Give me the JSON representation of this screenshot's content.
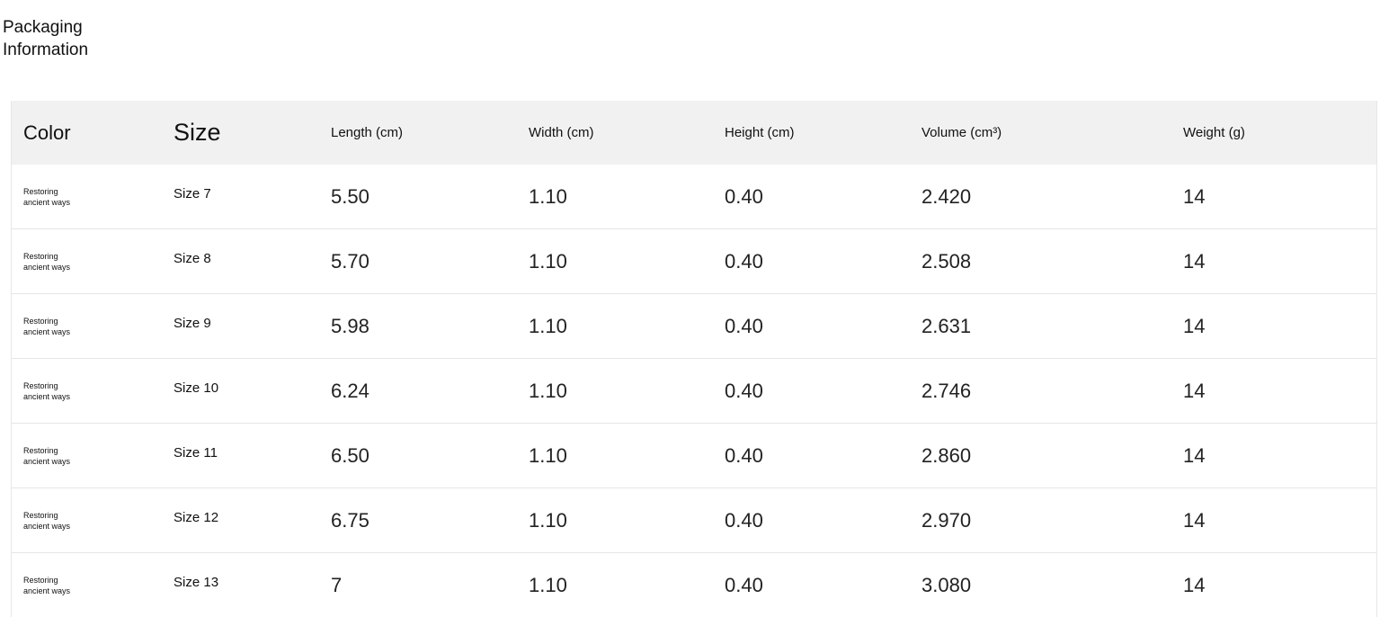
{
  "page": {
    "title": "Packaging\nInformation"
  },
  "table": {
    "headers": {
      "color": "Color",
      "size": "Size",
      "length": "Length (cm)",
      "width": "Width (cm)",
      "height": "Height (cm)",
      "volume": "Volume (cm³)",
      "weight": "Weight (g)"
    },
    "rows": [
      {
        "color": "Restoring ancient ways",
        "size": "Size 7",
        "length": "5.50",
        "width": "1.10",
        "height": "0.40",
        "volume": "2.420",
        "weight": "14"
      },
      {
        "color": "Restoring ancient ways",
        "size": "Size 8",
        "length": "5.70",
        "width": "1.10",
        "height": "0.40",
        "volume": "2.508",
        "weight": "14"
      },
      {
        "color": "Restoring ancient ways",
        "size": "Size 9",
        "length": "5.98",
        "width": "1.10",
        "height": "0.40",
        "volume": "2.631",
        "weight": "14"
      },
      {
        "color": "Restoring ancient ways",
        "size": "Size 10",
        "length": "6.24",
        "width": "1.10",
        "height": "0.40",
        "volume": "2.746",
        "weight": "14"
      },
      {
        "color": "Restoring ancient ways",
        "size": "Size 11",
        "length": "6.50",
        "width": "1.10",
        "height": "0.40",
        "volume": "2.860",
        "weight": "14"
      },
      {
        "color": "Restoring ancient ways",
        "size": "Size 12",
        "length": "6.75",
        "width": "1.10",
        "height": "0.40",
        "volume": "2.970",
        "weight": "14"
      },
      {
        "color": "Restoring ancient ways",
        "size": "Size 13",
        "length": "7",
        "width": "1.10",
        "height": "0.40",
        "volume": "3.080",
        "weight": "14"
      }
    ]
  }
}
